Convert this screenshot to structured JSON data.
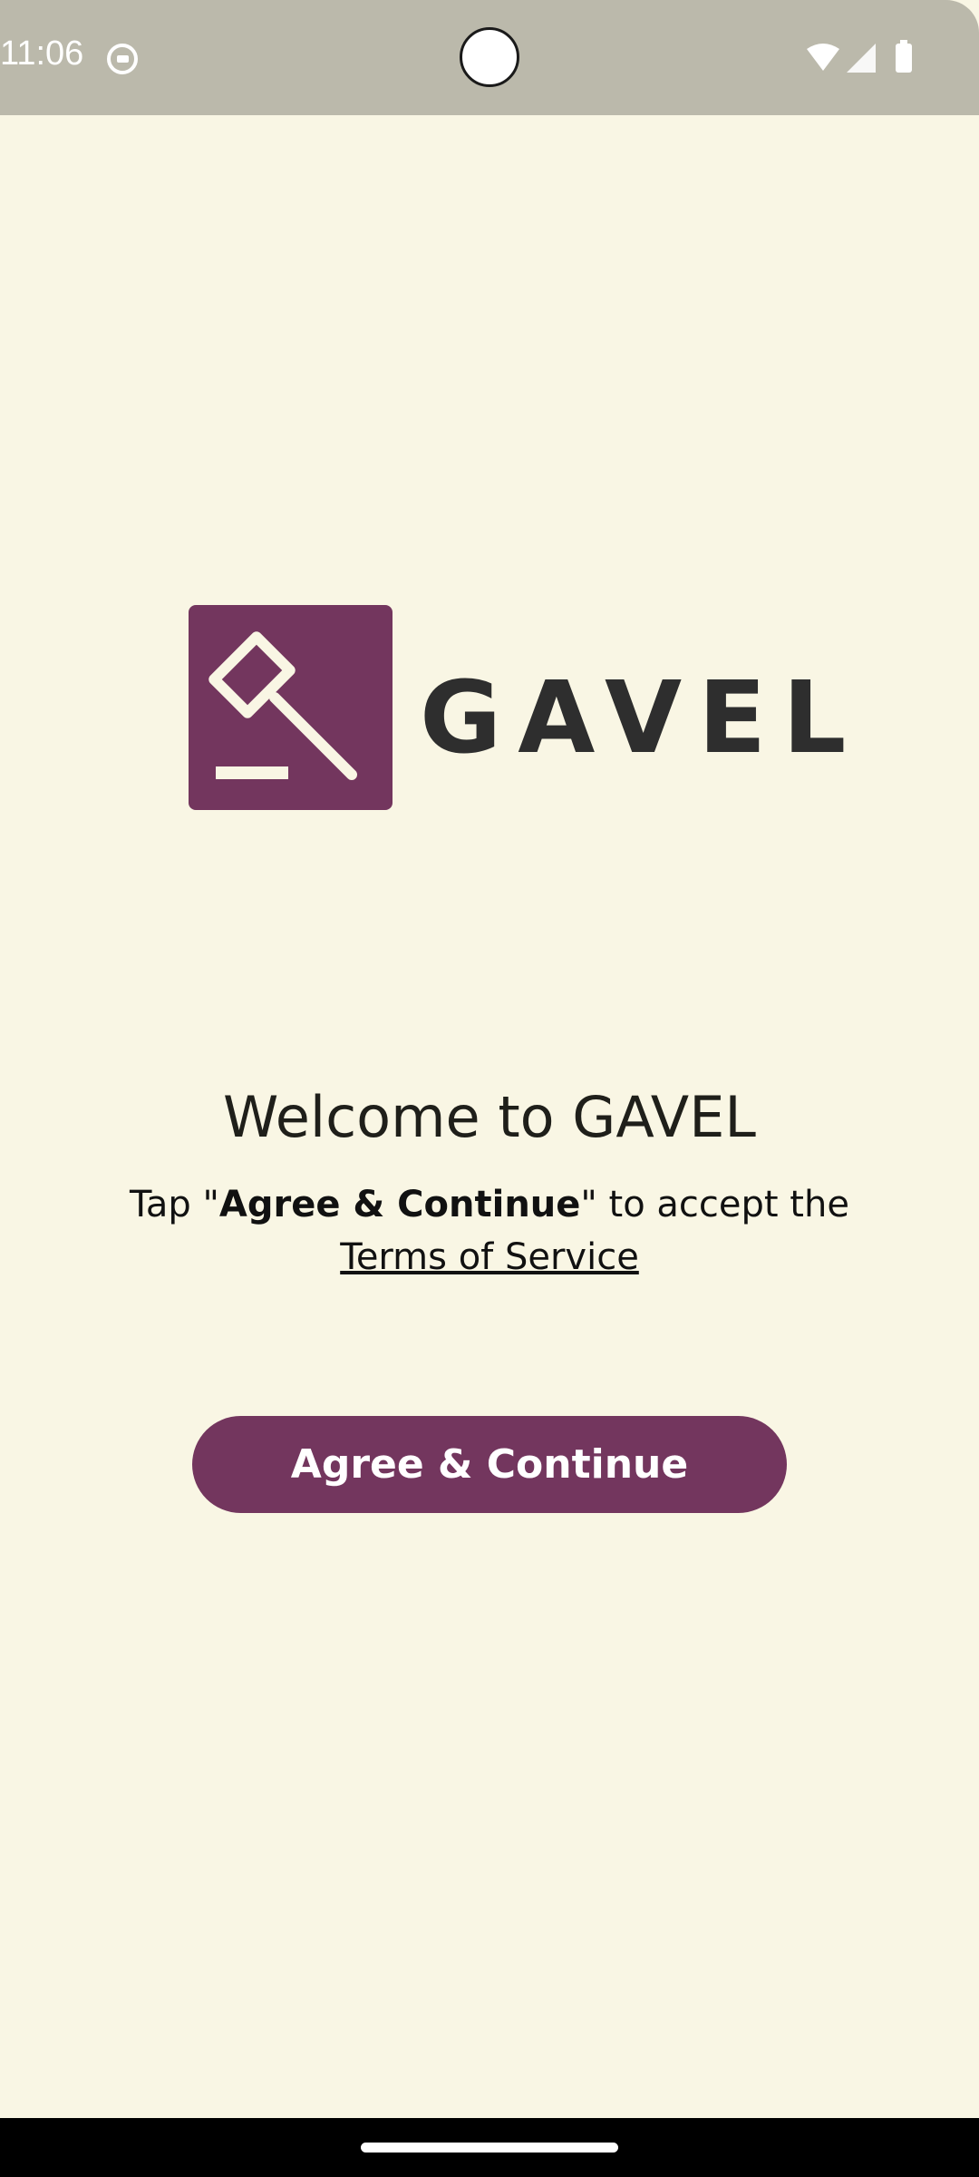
{
  "status_bar": {
    "time": "11:06",
    "icons": [
      "cat-notification-icon",
      "wifi-icon",
      "cellular-signal-icon",
      "battery-icon"
    ]
  },
  "logo": {
    "word": "GAVEL",
    "mark": "gavel-icon",
    "brand_color": "#73365e"
  },
  "welcome": {
    "title": "Welcome to GAVEL",
    "terms_prefix": "Tap \"",
    "terms_emphasis": "Agree & Continue",
    "terms_suffix": "\" to accept the",
    "terms_link": "Terms of Service"
  },
  "actions": {
    "agree_label": "Agree & Continue"
  },
  "colors": {
    "background": "#f9f6e4",
    "status_bar": "#bbb9ab",
    "accent": "#73365e"
  }
}
